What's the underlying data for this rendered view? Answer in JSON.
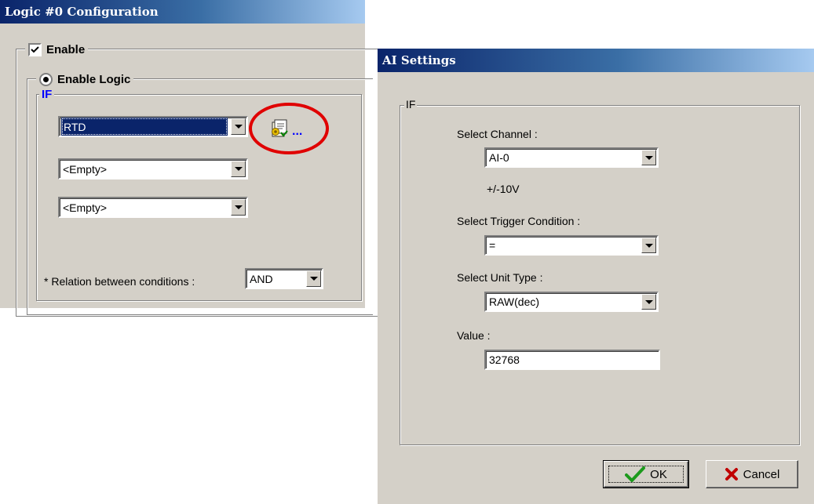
{
  "logic_window": {
    "title": "Logic #0 Configuration",
    "enable_label": "Enable",
    "enable_logic_label": "Enable Logic",
    "if_label": "IF",
    "conditions": [
      "RTD",
      "<Empty>",
      "<Empty>"
    ],
    "more_label": "...",
    "relation_label": "* Relation between conditions :",
    "relation_value": "AND",
    "highlight_color": "#e00000"
  },
  "ai_window": {
    "title": "AI Settings",
    "if_label": "IF",
    "channel_label": "Select Channel :",
    "channel_value": "AI-0",
    "channel_range": "+/-10V",
    "trigger_label": "Select Trigger Condition :",
    "trigger_value": "=",
    "unit_label": "Select Unit Type :",
    "unit_value": "RAW(dec)",
    "value_label": "Value :",
    "value": "32768",
    "ok_label": "OK",
    "cancel_label": "Cancel"
  }
}
